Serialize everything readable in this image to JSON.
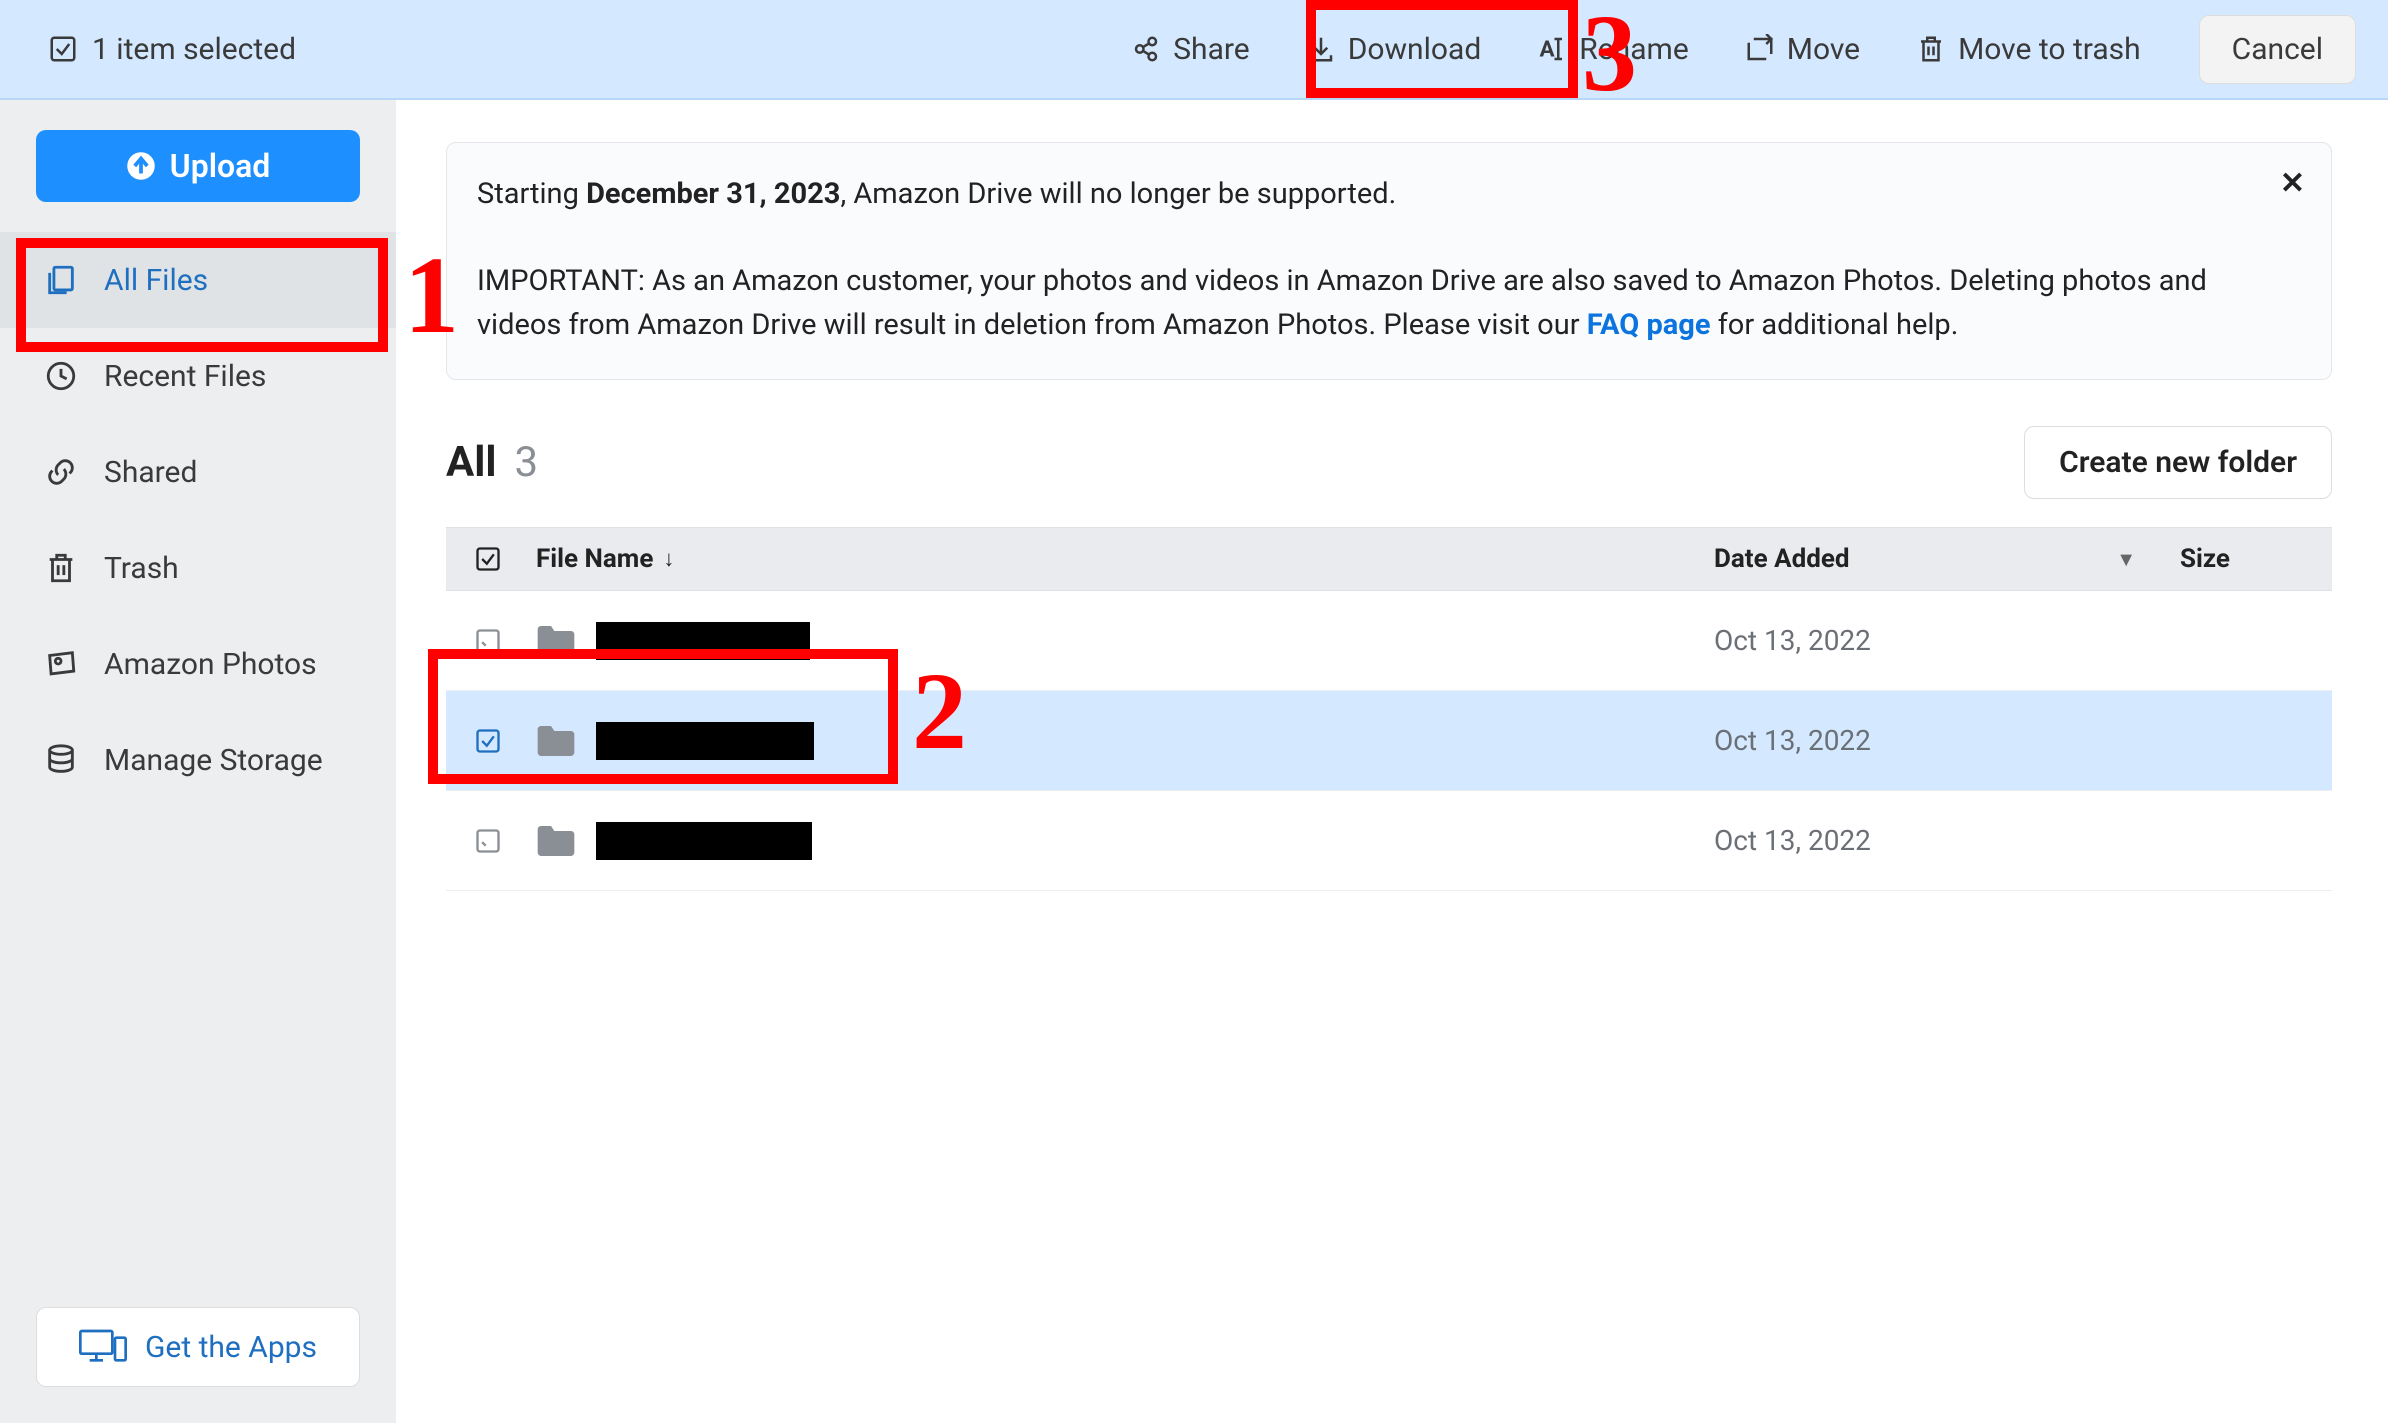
{
  "topbar": {
    "selected_text": "1 item selected",
    "actions": {
      "share": "Share",
      "download": "Download",
      "rename": "Rename",
      "move": "Move",
      "trash": "Move to trash"
    },
    "cancel": "Cancel"
  },
  "sidebar": {
    "upload": "Upload",
    "items": [
      {
        "label": "All Files"
      },
      {
        "label": "Recent Files"
      },
      {
        "label": "Shared"
      },
      {
        "label": "Trash"
      },
      {
        "label": "Amazon Photos"
      },
      {
        "label": "Manage Storage"
      }
    ],
    "get_apps": "Get the Apps"
  },
  "notice": {
    "line1_pre": "Starting ",
    "line1_bold": "December 31, 2023",
    "line1_post": ", Amazon Drive will no longer be supported.",
    "line2_pre": "IMPORTANT: As an Amazon customer, your photos and videos in Amazon Drive are also saved to Amazon Photos. Deleting photos and videos from Amazon Drive will result in deletion from Amazon Photos. Please visit our ",
    "faq": "FAQ page",
    "line2_post": " for additional help."
  },
  "list": {
    "title": "All",
    "count": "3",
    "new_folder": "Create new folder",
    "cols": {
      "name": "File Name",
      "date": "Date Added",
      "size": "Size"
    },
    "rows": [
      {
        "date": "Oct 13, 2022",
        "size": "",
        "selected": false
      },
      {
        "date": "Oct 13, 2022",
        "size": "",
        "selected": true
      },
      {
        "date": "Oct 13, 2022",
        "size": "",
        "selected": false
      }
    ]
  },
  "annotations": {
    "n1": "1",
    "n2": "2",
    "n3": "3"
  }
}
